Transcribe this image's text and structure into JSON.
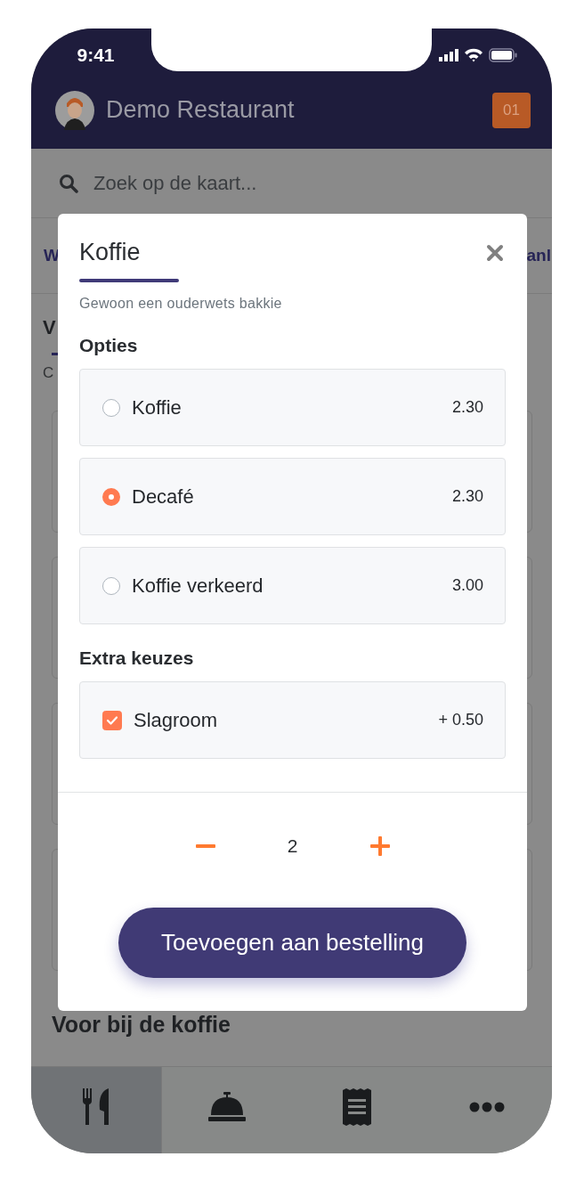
{
  "status_bar": {
    "time": "9:41"
  },
  "header": {
    "title": "Demo Restaurant",
    "table_badge": "01"
  },
  "search": {
    "placeholder": "Zoek op de kaart..."
  },
  "tabs": [
    {
      "label": "W"
    },
    {
      "label": "anl"
    }
  ],
  "section": {
    "heading": "V",
    "subtitle": "C"
  },
  "next_section": {
    "heading": "Voor bij de koffie"
  },
  "bottom_nav": [
    {
      "selected": true
    },
    {
      "selected": false
    },
    {
      "selected": false
    },
    {
      "selected": false
    }
  ],
  "modal": {
    "title": "Koffie",
    "description": "Gewoon een ouderwets bakkie",
    "options_heading": "Opties",
    "options": [
      {
        "label": "Koffie",
        "price": "2.30",
        "selected": false
      },
      {
        "label": "Decafé",
        "price": "2.30",
        "selected": true
      },
      {
        "label": "Koffie verkeerd",
        "price": "3.00",
        "selected": false
      }
    ],
    "extras_heading": "Extra keuzes",
    "extras": [
      {
        "label": "Slagroom",
        "price": "+ 0.50",
        "checked": true
      }
    ],
    "quantity": "2",
    "submit": "Toevoegen aan bestelling"
  }
}
